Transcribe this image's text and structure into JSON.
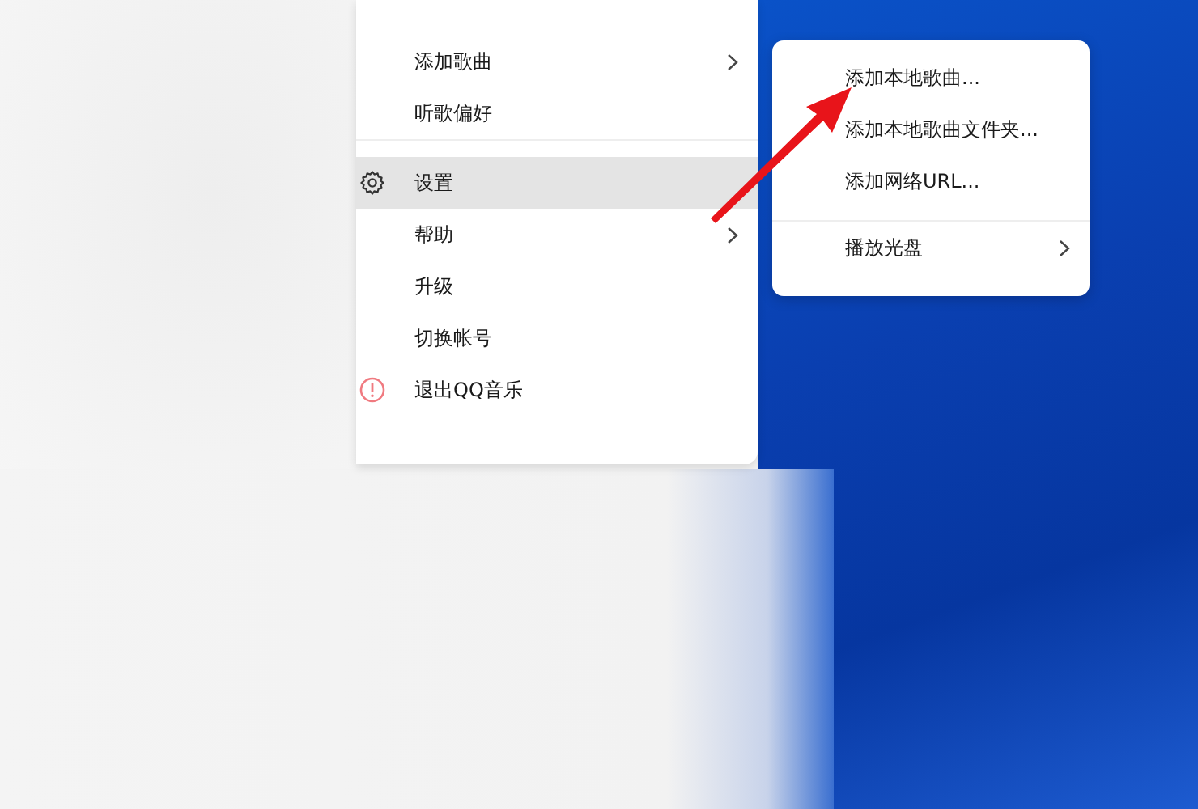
{
  "main_menu": {
    "sections": [
      {
        "items": [
          {
            "label": "添加歌曲",
            "submenu": true,
            "kind": "plain",
            "selected": false
          },
          {
            "label": "听歌偏好",
            "submenu": false,
            "kind": "plain",
            "selected": false
          }
        ]
      },
      {
        "items": [
          {
            "label": "设置",
            "submenu": false,
            "kind": "settings",
            "selected": true
          },
          {
            "label": "帮助",
            "submenu": true,
            "kind": "plain",
            "selected": false
          },
          {
            "label": "升级",
            "submenu": false,
            "kind": "plain",
            "selected": false
          },
          {
            "label": "切换帐号",
            "submenu": false,
            "kind": "plain",
            "selected": false
          },
          {
            "label": "退出QQ音乐",
            "submenu": false,
            "kind": "exit",
            "selected": false
          }
        ]
      }
    ]
  },
  "submenu": {
    "sections": [
      {
        "items": [
          {
            "label": "添加本地歌曲...",
            "submenu": false
          },
          {
            "label": "添加本地歌曲文件夹...",
            "submenu": false
          },
          {
            "label": "添加网络URL...",
            "submenu": false
          }
        ]
      },
      {
        "items": [
          {
            "label": "播放光盘",
            "submenu": true
          }
        ]
      }
    ]
  }
}
